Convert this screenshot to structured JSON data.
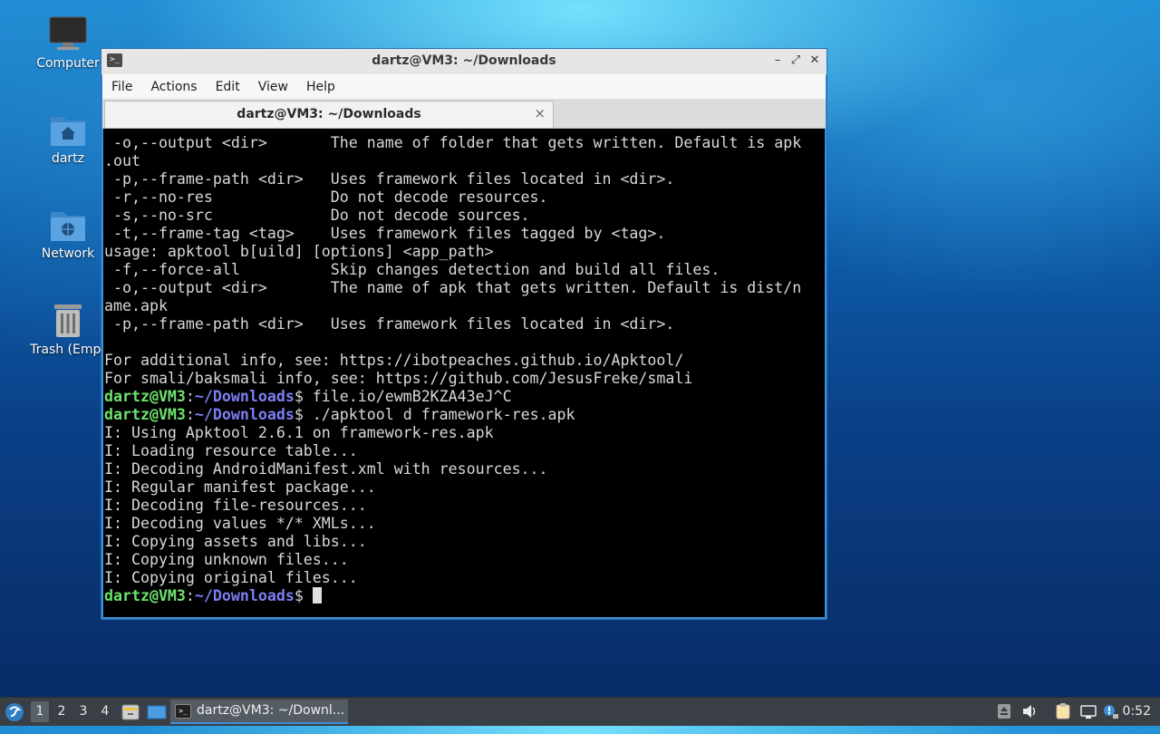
{
  "desktop": {
    "icons": [
      {
        "label": "Computer"
      },
      {
        "label": "dartz"
      },
      {
        "label": "Network"
      },
      {
        "label": "Trash (Empt"
      }
    ]
  },
  "window": {
    "title": "dartz@VM3: ~/Downloads",
    "menu": [
      "File",
      "Actions",
      "Edit",
      "View",
      "Help"
    ],
    "tab_label": "dartz@VM3: ~/Downloads",
    "tab_close": "×",
    "controls": {
      "minimize": "–",
      "maximize": "⤢",
      "close": "✕"
    }
  },
  "terminal": {
    "prompt_user": "dartz@VM3",
    "prompt_path": "~/Downloads",
    "lines": [
      " -o,--output <dir>       The name of folder that gets written. Default is apk",
      ".out",
      " -p,--frame-path <dir>   Uses framework files located in <dir>.",
      " -r,--no-res             Do not decode resources.",
      " -s,--no-src             Do not decode sources.",
      " -t,--frame-tag <tag>    Uses framework files tagged by <tag>.",
      "usage: apktool b[uild] [options] <app_path>",
      " -f,--force-all          Skip changes detection and build all files.",
      " -o,--output <dir>       The name of apk that gets written. Default is dist/n",
      "ame.apk",
      " -p,--frame-path <dir>   Uses framework files located in <dir>.",
      "",
      "For additional info, see: https://ibotpeaches.github.io/Apktool/",
      "For smali/baksmali info, see: https://github.com/JesusFreke/smali"
    ],
    "cmd1": "$ file.io/ewmB2KZA43eJ^C",
    "cmd2": "$ ./apktool d framework-res.apk",
    "output": [
      "I: Using Apktool 2.6.1 on framework-res.apk",
      "I: Loading resource table...",
      "I: Decoding AndroidManifest.xml with resources...",
      "I: Regular manifest package...",
      "I: Decoding file-resources...",
      "I: Decoding values */* XMLs...",
      "I: Copying assets and libs...",
      "I: Copying unknown files...",
      "I: Copying original files..."
    ],
    "final_prompt_suffix": "$ "
  },
  "taskbar": {
    "workspaces": [
      "1",
      "2",
      "3",
      "4"
    ],
    "task_label": "dartz@VM3: ~/Downl...",
    "clock": "0:52"
  },
  "colors": {
    "prompt_user": "#6ee36e",
    "prompt_path": "#7d7df5",
    "accent": "#3b8fd9"
  }
}
